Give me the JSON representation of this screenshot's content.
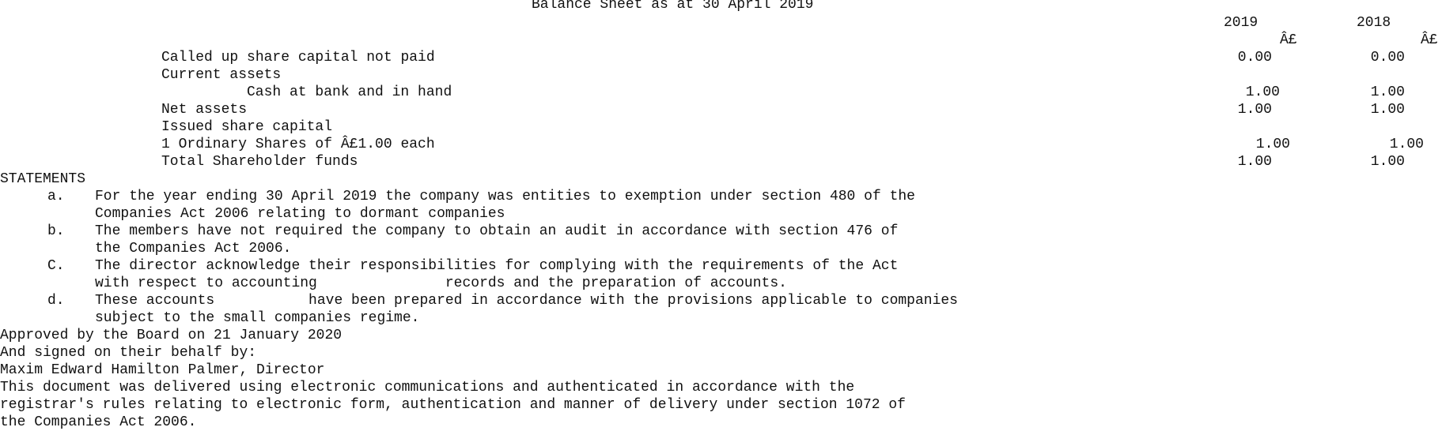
{
  "title": "Balance Sheet as at 30 April 2019",
  "columns": {
    "year_2019": "2019",
    "year_2018": "2018",
    "currency_2019": "Â£",
    "currency_2018": "Â£"
  },
  "balance_sheet": {
    "rows": [
      {
        "label": "Called up share capital not paid",
        "v2019": "0.00",
        "v2018": "0.00"
      },
      {
        "label": "Current assets",
        "v2019": "",
        "v2018": ""
      },
      {
        "label": "Cash at bank and in hand",
        "v2019": "1.00",
        "v2018": "1.00"
      },
      {
        "label": "Net assets",
        "v2019": "1.00",
        "v2018": "1.00"
      },
      {
        "label": "Issued share capital",
        "v2019": "",
        "v2018": ""
      },
      {
        "label": "1 Ordinary Shares of Â£1.00 each",
        "v2019": "1.00",
        "v2018": "1.00"
      },
      {
        "label": "Total Shareholder funds",
        "v2019": "1.00",
        "v2018": "1.00"
      }
    ]
  },
  "statements": {
    "heading": "STATEMENTS",
    "items": [
      {
        "marker": "a.",
        "lines": [
          "For the year ending 30 April 2019 the company was entities to exemption under section 480 of the",
          "Companies Act 2006 relating to dormant companies"
        ]
      },
      {
        "marker": "b.",
        "lines": [
          "The members have not required the company to obtain an audit in accordance with section 476 of",
          "the Companies Act 2006."
        ]
      },
      {
        "marker": "C.",
        "lines": [
          "The director acknowledge their responsibilities for complying with the requirements of the Act",
          "with respect to accounting               records and the preparation of accounts."
        ]
      },
      {
        "marker": "d.",
        "lines": [
          "These accounts           have been prepared in accordance with the provisions applicable to companies",
          "subject to the small companies regime."
        ]
      }
    ]
  },
  "approval": {
    "approved": "Approved by the Board on 21 January 2020",
    "signed": "And signed on their behalf by:",
    "director": "Maxim Edward Hamilton Palmer, Director"
  },
  "footer": {
    "lines": [
      "This document was delivered using electronic communications and authenticated in accordance with the",
      "registrar's rules relating to electronic form, authentication and manner of delivery under section 1072 of",
      "the Companies Act 2006."
    ]
  }
}
